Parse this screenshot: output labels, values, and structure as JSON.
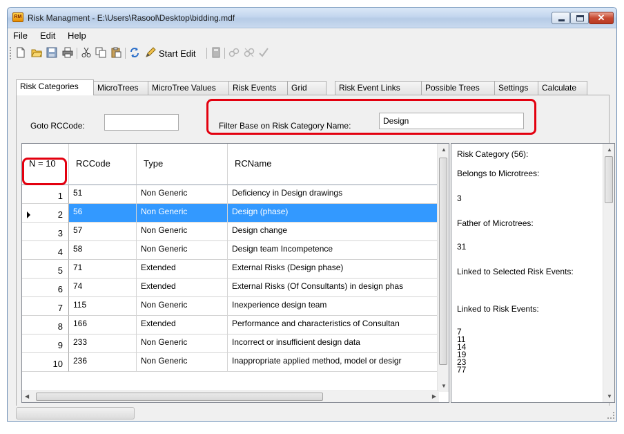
{
  "window": {
    "title": "Risk Managment - E:\\Users\\Rasool\\Desktop\\bidding.mdf",
    "app_icon_label": "RM",
    "close_glyph": "✕"
  },
  "menu": [
    "File",
    "Edit",
    "Help"
  ],
  "toolbar": {
    "start_edit": "Start Edit"
  },
  "tabs": [
    "Risk Categories",
    "MicroTrees",
    "MicroTree Values",
    "Risk Events",
    "Grid",
    "Risk Event Links",
    "Possible Trees",
    "Settings",
    "Calculate"
  ],
  "filters": {
    "goto_label": "Goto RCCode:",
    "goto_value": "",
    "filter_label": "Filter Base on Risk Category Name:",
    "filter_value": "Design"
  },
  "grid": {
    "count_label": "N = 10",
    "columns": [
      "RCCode",
      "Type",
      "RCName"
    ],
    "selected_row": 2,
    "rows": [
      {
        "n": "1",
        "code": "51",
        "type": "Non Generic",
        "name": "Deficiency in Design drawings"
      },
      {
        "n": "2",
        "code": "56",
        "type": "Non Generic",
        "name": "Design (phase)"
      },
      {
        "n": "3",
        "code": "57",
        "type": "Non Generic",
        "name": "Design change"
      },
      {
        "n": "4",
        "code": "58",
        "type": "Non Generic",
        "name": "Design team Incompetence"
      },
      {
        "n": "5",
        "code": "71",
        "type": "Extended",
        "name": "External Risks (Design phase)"
      },
      {
        "n": "6",
        "code": "74",
        "type": "Extended",
        "name": "External Risks (Of Consultants) in design phas"
      },
      {
        "n": "7",
        "code": "115",
        "type": "Non Generic",
        "name": "Inexperience design team"
      },
      {
        "n": "8",
        "code": "166",
        "type": "Extended",
        "name": "Performance and characteristics of Consultan"
      },
      {
        "n": "9",
        "code": "233",
        "type": "Non Generic",
        "name": "Incorrect or insufficient design data"
      },
      {
        "n": "10",
        "code": "236",
        "type": "Non Generic",
        "name": "Inappropriate applied method, model or desigr"
      }
    ]
  },
  "info": {
    "category": "Risk Category (56):",
    "belongs_label": "Belongs to Microtrees:",
    "belongs_value": "3",
    "father_label": "Father of Microtrees:",
    "father_value": "31",
    "linked_selected_label": "Linked to Selected Risk Events:",
    "linked_label": "Linked to Risk Events:",
    "linked_values": [
      "7",
      "11",
      "14",
      "19",
      "23",
      "77"
    ]
  },
  "colors": {
    "highlight": "#e3000f",
    "selection": "#3399ff"
  }
}
